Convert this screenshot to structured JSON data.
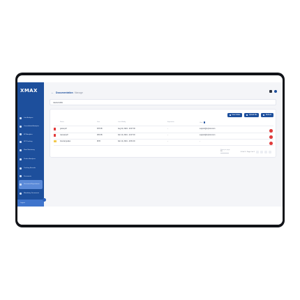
{
  "app": {
    "logo": "MAX",
    "logo_prefix": "X"
  },
  "header": {
    "title": "Documentation",
    "subtitle": "Manage"
  },
  "sidebar": {
    "items": [
      {
        "label": "Last Analyses"
      },
      {
        "label": "Consolidated Analytics"
      },
      {
        "label": "KPI Analytics"
      },
      {
        "label": "KPI Tracking"
      },
      {
        "label": "Fleet Monitoring"
      },
      {
        "label": "Product Analyses"
      },
      {
        "label": "Tracking Records"
      },
      {
        "label": "Documents"
      },
      {
        "label": "Document Repositories"
      },
      {
        "label": "Mandatory Documents"
      },
      {
        "label": "Traceability"
      }
    ],
    "active_index": 8,
    "footer": "Logout"
  },
  "path": {
    "value": "CEO21384"
  },
  "toolbar": {
    "new_folder": "New Folder",
    "upload_file": "Upload File",
    "refresh": "Refresh"
  },
  "table": {
    "columns": [
      "Name",
      "Size",
      "Last Modify",
      "Expiration",
      "User"
    ],
    "rows": [
      {
        "type": "pdf",
        "name": "guide.pdf",
        "size": "678 KB",
        "date": "Aug 22, 2024 - 10:47:00",
        "expiration": "-",
        "user": "support@myhost.com"
      },
      {
        "type": "pdf",
        "name": "manual.pdf",
        "size": "465 KB",
        "date": "Feb 12, 2024 - 14:27:00",
        "expiration": "-",
        "user": "support@myhost.com"
      },
      {
        "type": "folder",
        "name": "Internal guides",
        "size": "98 B",
        "date": "Feb 12, 2024 - 10:51:00",
        "expiration": "-",
        "user": "-"
      }
    ]
  },
  "pagination": {
    "rows_per_page_label": "Rows per page",
    "rows_per_page": "10",
    "range": "1-3 of 3 · Page 1 of 1"
  }
}
